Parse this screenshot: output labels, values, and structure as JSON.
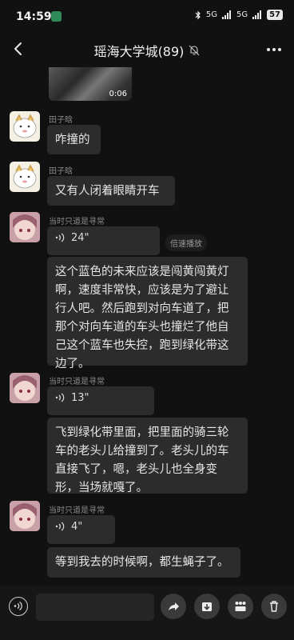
{
  "status_bar": {
    "time": "14:59",
    "network_1": "5G",
    "network_2": "5G",
    "battery": "57"
  },
  "header": {
    "title": "瑶海大学城(89)"
  },
  "video": {
    "duration": "0:06"
  },
  "messages": [
    {
      "sender": "田子晗",
      "text": "咋撞的"
    },
    {
      "sender": "田子晗",
      "text": "又有人闭着眼睛开车"
    },
    {
      "sender": "当时只道是寻常",
      "voice_duration": "24\"",
      "speed_label": "倍速播放",
      "transcript": "这个蓝色的未来应该是闯黄闯黄灯啊，速度非常快，应该是为了避让行人吧。然后跑到对向车道了，把那个对向车道的车头也撞烂了他自己这个蓝车也失控，跑到绿化带这边了。"
    },
    {
      "sender": "当时只道是寻常",
      "voice_duration": "13\"",
      "transcript": "飞到绿化带里面，把里面的骑三轮车的老头儿给撞到了。老头儿的车直接飞了，嗯，老头儿也全身变形，当场就嘎了。"
    },
    {
      "sender": "当时只道是寻常",
      "voice_duration": "4\"",
      "transcript": "等到我去的时候啊，都生蝇子了。"
    }
  ],
  "icons": {
    "back": "chevron-left-icon",
    "mute": "bell-off-icon",
    "more": "more-icon",
    "voice": "voice-wave-icon",
    "share": "share-icon",
    "download": "download-icon",
    "grid": "grid-icon",
    "delete": "trash-icon"
  },
  "colors": {
    "background": "#111111",
    "bubble": "#2c2c2c",
    "muted_text": "#8a8a8a"
  }
}
